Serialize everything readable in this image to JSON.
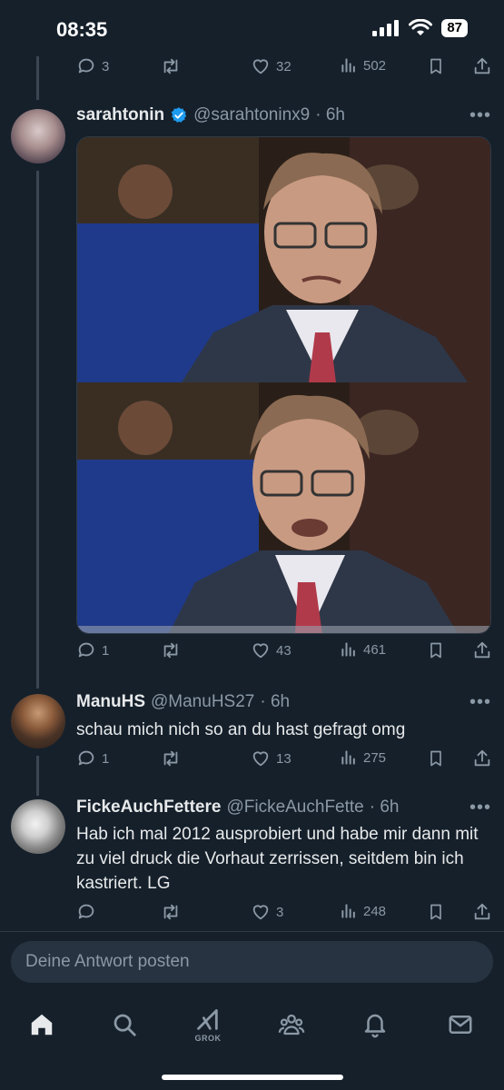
{
  "status_bar": {
    "time": "08:35",
    "battery": "87"
  },
  "top_actions": {
    "replies": "3",
    "retweets": "",
    "likes": "32",
    "views": "502"
  },
  "tweets": [
    {
      "name": "sarahtonin",
      "verified": true,
      "handle": "@sarahtoninx9",
      "time": "· 6h",
      "text": "",
      "has_media": true,
      "actions": {
        "replies": "1",
        "retweets": "",
        "likes": "43",
        "views": "461"
      }
    },
    {
      "name": "ManuHS",
      "verified": false,
      "handle": "@ManuHS27",
      "time": "· 6h",
      "text": "schau mich nich so an du hast gefragt omg",
      "has_media": false,
      "actions": {
        "replies": "1",
        "retweets": "",
        "likes": "13",
        "views": "275"
      }
    },
    {
      "name": "FickeAuchFettere",
      "verified": false,
      "handle": "@FickeAuchFette",
      "time": "· 6h",
      "text": "Hab ich mal 2012 ausprobiert und habe mir dann mit zu viel druck die Vorhaut zerrissen, seitdem bin ich kastriert. LG",
      "has_media": false,
      "actions": {
        "replies": "",
        "retweets": "",
        "likes": "3",
        "views": "248"
      }
    }
  ],
  "reply_box": {
    "placeholder": "Deine Antwort posten"
  },
  "nav": {
    "grok_label": "GROK"
  },
  "icons": {
    "reply": "reply-icon",
    "retweet": "retweet-icon",
    "like": "heart-icon",
    "views": "views-icon",
    "bookmark": "bookmark-icon",
    "share": "share-icon",
    "home": "home-icon",
    "search": "search-icon",
    "grok": "grok-icon",
    "communities": "communities-icon",
    "notifications": "bell-icon",
    "messages": "mail-icon"
  },
  "colors": {
    "background": "#15202b",
    "text": "#e7e9ea",
    "muted": "#8b98a5",
    "verified": "#1d9bf0"
  }
}
